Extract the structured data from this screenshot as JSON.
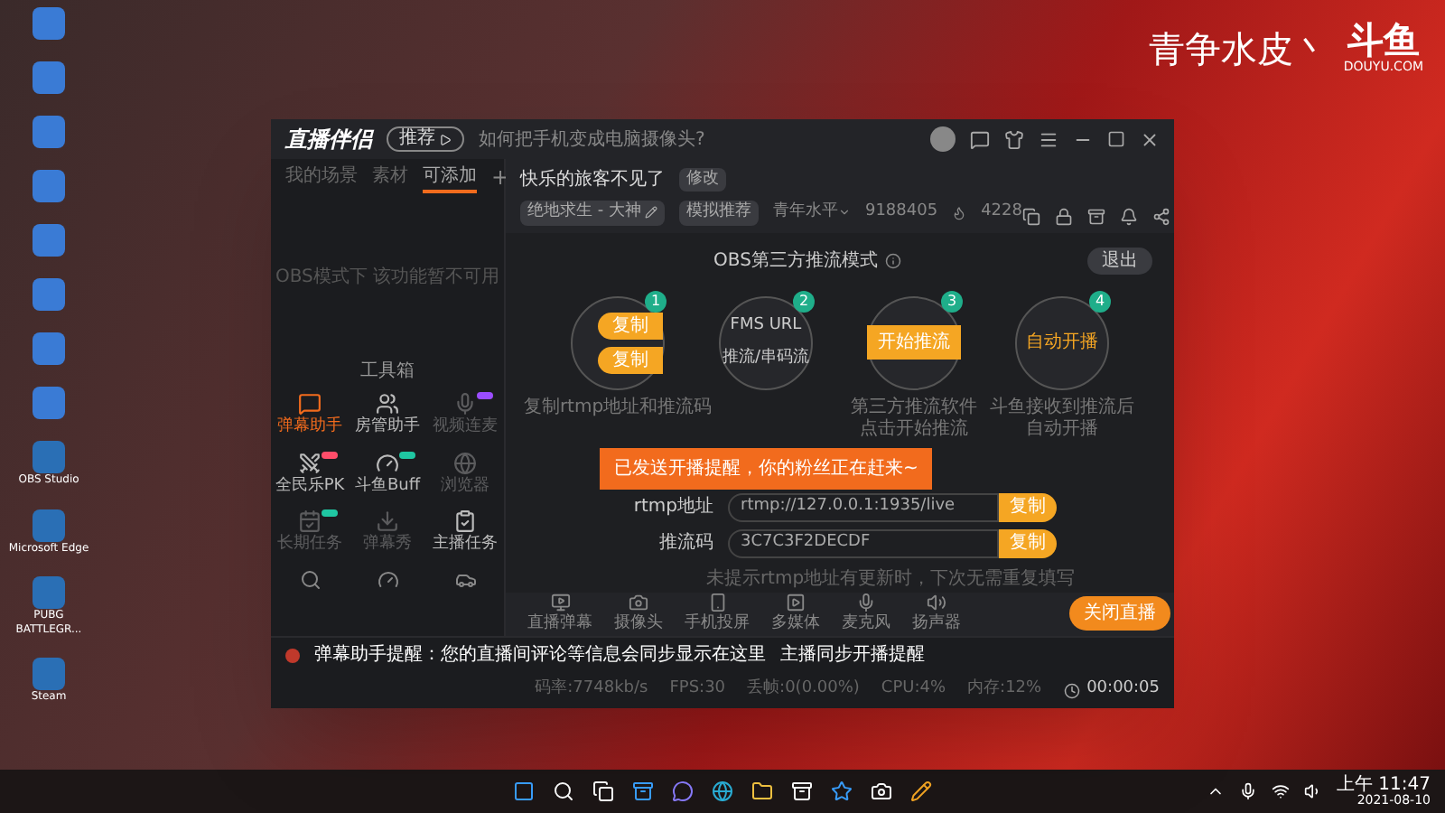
{
  "desktop": {
    "icons": [
      {
        "label": "OBS Studio"
      },
      {
        "label": "Microsoft Edge"
      },
      {
        "label": "PUBG BATTLEGR..."
      },
      {
        "label": "Steam"
      }
    ],
    "overlay": {
      "title": "青争水皮丶",
      "logo": "斗鱼",
      "logo_caption": "DOUYU.COM"
    }
  },
  "window": {
    "app_name": "直播伴侣",
    "badge": "推荐",
    "hint": "如何把手机变成电脑摄像头?"
  },
  "left_panel": {
    "tabs": [
      {
        "label": "我的场景",
        "selected": false
      },
      {
        "label": "素材",
        "selected": false
      },
      {
        "label": "可添加",
        "selected": true
      }
    ],
    "add_tab": "+",
    "empty_message": "OBS模式下 该功能暂不可用",
    "toolbox_title": "工具箱",
    "tools": [
      {
        "label": "弹幕助手",
        "active": true,
        "disabled": false
      },
      {
        "label": "房管助手",
        "active": false,
        "disabled": false
      },
      {
        "label": "视频连麦",
        "active": false,
        "disabled": true,
        "color": "#9b4dff"
      },
      {
        "label": "全民乐PK",
        "active": false,
        "disabled": false,
        "color": "#ff4d6a"
      },
      {
        "label": "斗鱼Buff",
        "active": false,
        "disabled": false,
        "color": "#1fc7a2"
      },
      {
        "label": "浏览器",
        "active": false,
        "disabled": true
      },
      {
        "label": "长期任务",
        "active": false,
        "disabled": true,
        "color": "#1fc7a2"
      },
      {
        "label": "弹幕秀",
        "active": false,
        "disabled": true
      },
      {
        "label": "主播任务",
        "active": false,
        "disabled": false
      }
    ],
    "notices": [
      "弹幕助手提醒：您的直播间评论等信息会同步显示在这里",
      "主播同步开播提醒"
    ]
  },
  "room": {
    "title": "快乐的旅客不见了",
    "edit": "修改",
    "category": "绝地求生 - 大神",
    "recommend": "模拟推荐",
    "level": "青年水平",
    "followers": "9188405",
    "heat": "4228"
  },
  "obs": {
    "title": "OBS第三方推流模式",
    "exit": "退出",
    "steps": [
      {
        "number": "1",
        "kind": "copy",
        "buttons": [
          "复制",
          "复制"
        ],
        "caption": [
          "复制rtmp地址和推流码"
        ]
      },
      {
        "number": "2",
        "kind": "fields",
        "lines": [
          "FMS URL",
          "推流/串码流"
        ]
      },
      {
        "number": "3",
        "kind": "button",
        "button": "开始推流",
        "caption": [
          "第三方推流软件",
          "点击开始推流"
        ]
      },
      {
        "number": "4",
        "kind": "text",
        "text": "自动开播",
        "caption": [
          "斗鱼接收到推流后",
          "自动开播"
        ]
      }
    ],
    "toast": "已发送开播提醒，你的粉丝正在赶来~",
    "fields": [
      {
        "label": "rtmp地址",
        "value": "rtmp://127.0.0.1:1935/live",
        "action": "复制"
      },
      {
        "label": "推流码",
        "value": "3C7C3F2DECDF",
        "action": "复制"
      }
    ],
    "note": "未提示rtmp地址有更新时，下次无需重复填写"
  },
  "toolbar": {
    "items": [
      "直播弹幕",
      "摄像头",
      "手机投屏",
      "多媒体",
      "麦克风",
      "扬声器"
    ],
    "stop": "关闭直播"
  },
  "status": {
    "items": [
      "码率:7748kb/s",
      "FPS:30",
      "丢帧:0(0.00%)",
      "CPU:4%",
      "内存:12%"
    ],
    "time": "00:00:05"
  },
  "taskbar": {
    "time": "上午 11:47",
    "date": "2021-08-10"
  }
}
